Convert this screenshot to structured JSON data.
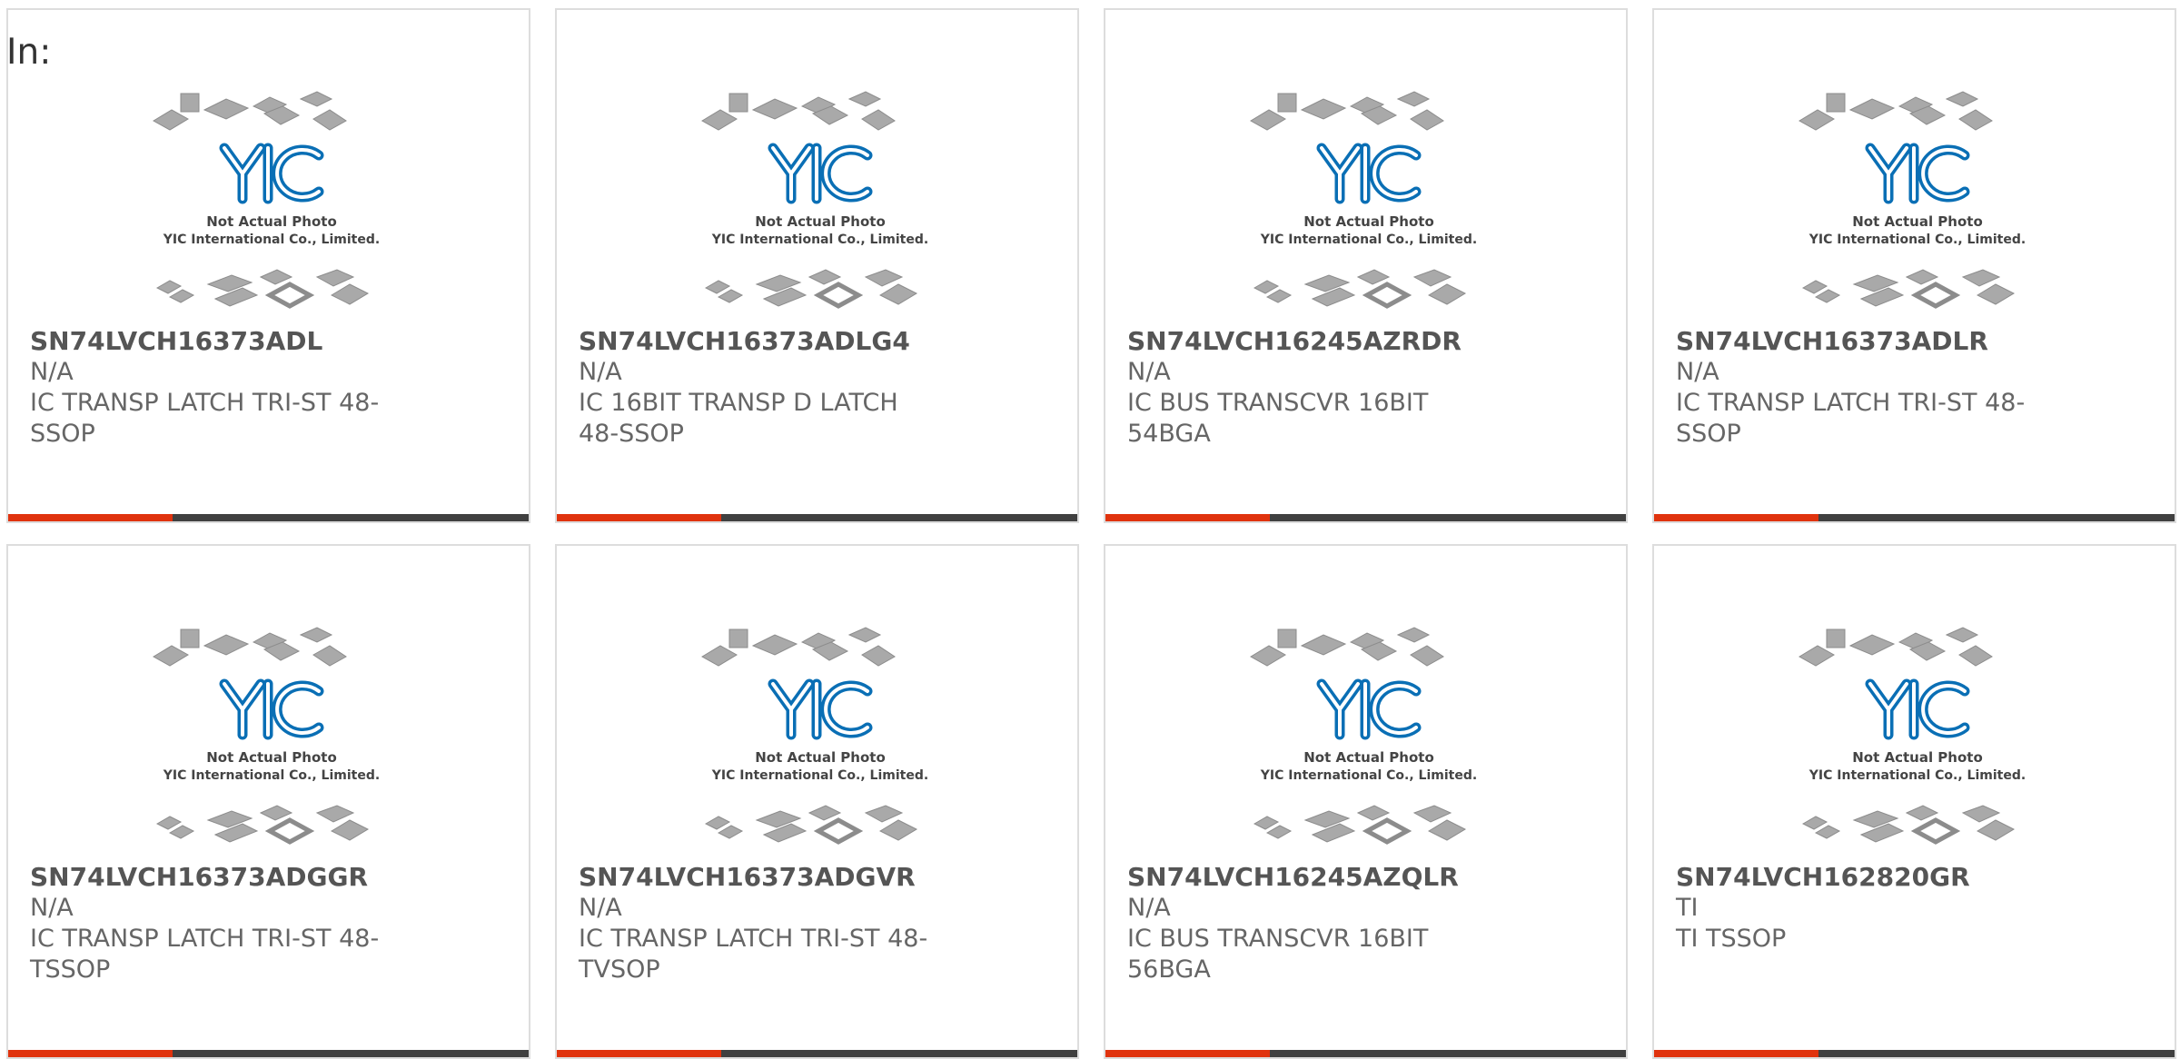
{
  "page": {
    "in_label": "In:"
  },
  "accent_color": "#e0330e",
  "image_caption": {
    "line1": "Not Actual Photo",
    "line2": "YIC International Co., Limited."
  },
  "products": [
    {
      "part": "SN74LVCH16373ADL",
      "brand": "N/A",
      "desc": "IC TRANSP LATCH TRI-ST 48-SSOP"
    },
    {
      "part": "SN74LVCH16373ADLG4",
      "brand": "N/A",
      "desc": "IC 16BIT TRANSP D LATCH 48-SSOP"
    },
    {
      "part": "SN74LVCH16245AZRDR",
      "brand": "N/A",
      "desc": "IC BUS TRANSCVR 16BIT 54BGA"
    },
    {
      "part": "SN74LVCH16373ADLR",
      "brand": "N/A",
      "desc": "IC TRANSP LATCH TRI-ST 48-SSOP"
    },
    {
      "part": "SN74LVCH16373ADGGR",
      "brand": "N/A",
      "desc": "IC TRANSP LATCH TRI-ST 48-TSSOP"
    },
    {
      "part": "SN74LVCH16373ADGVR",
      "brand": "N/A",
      "desc": "IC TRANSP LATCH TRI-ST 48-TVSOP"
    },
    {
      "part": "SN74LVCH16245AZQLR",
      "brand": "N/A",
      "desc": "IC BUS TRANSCVR 16BIT 56BGA"
    },
    {
      "part": "SN74LVCH162820GR",
      "brand": "TI",
      "desc": "TI TSSOP"
    }
  ]
}
